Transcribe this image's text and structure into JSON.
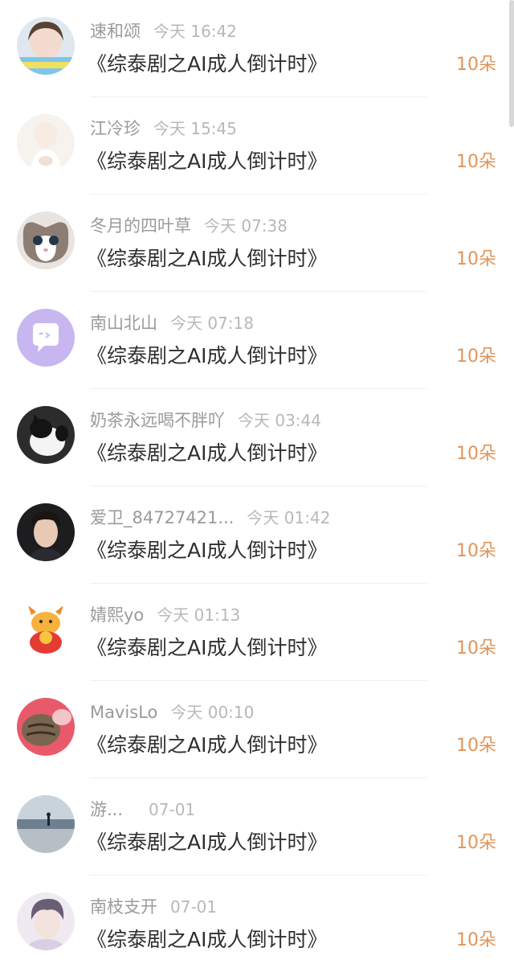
{
  "items": [
    {
      "name": "速和颂",
      "time": "今天 16:42",
      "book": "《综泰剧之AI成人倒计时》",
      "gift": "10朵",
      "avatar": "avatar-girl-icon"
    },
    {
      "name": "江冷珍",
      "time": "今天 15:45",
      "book": "《综泰剧之AI成人倒计时》",
      "gift": "10朵",
      "avatar": "avatar-light-girl-icon"
    },
    {
      "name": "冬月的四叶草",
      "time": "今天 07:38",
      "book": "《综泰剧之AI成人倒计时》",
      "gift": "10朵",
      "avatar": "avatar-cat-icon"
    },
    {
      "name": "南山北山",
      "time": "今天 07:18",
      "book": "《综泰剧之AI成人倒计时》",
      "gift": "10朵",
      "avatar": "avatar-default-chat-icon"
    },
    {
      "name": "奶茶永远喝不胖吖",
      "time": "今天 03:44",
      "book": "《综泰剧之AI成人倒计时》",
      "gift": "10朵",
      "avatar": "avatar-black-white-cat-icon"
    },
    {
      "name": "爱卫_84727421...",
      "time": "今天 01:42",
      "book": "《综泰剧之AI成人倒计时》",
      "gift": "10朵",
      "avatar": "avatar-man-icon"
    },
    {
      "name": "婧熙yo",
      "time": "今天 01:13",
      "book": "《综泰剧之AI成人倒计时》",
      "gift": "10朵",
      "avatar": "avatar-dragon-sticker-icon"
    },
    {
      "name": "MavisLo",
      "time": "今天 00:10",
      "book": "《综泰剧之AI成人倒计时》",
      "gift": "10朵",
      "avatar": "avatar-tabby-cat-icon"
    },
    {
      "name": "游...",
      "time": "07-01",
      "book": "《综泰剧之AI成人倒计时》",
      "gift": "10朵",
      "avatar": "avatar-beach-icon"
    },
    {
      "name": "南枝支开",
      "time": "07-01",
      "book": "《综泰剧之AI成人倒计时》",
      "gift": "10朵",
      "avatar": "avatar-anime-boy-icon"
    }
  ],
  "colors": {
    "name": "#9a9a9a",
    "time": "#b8b8b8",
    "book": "#2f2f2f",
    "gift": "#e0955a",
    "default_avatar": "#c8b6f0"
  }
}
